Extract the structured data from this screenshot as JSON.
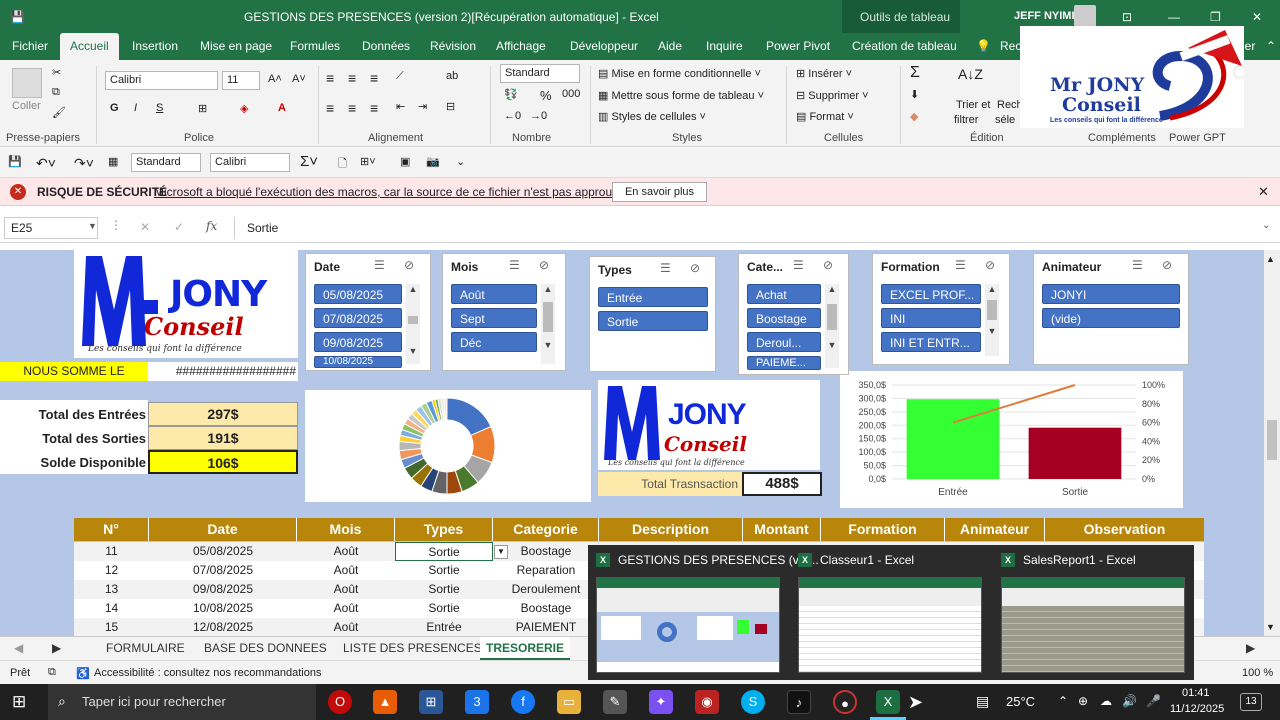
{
  "title": {
    "doc": "GESTIONS DES PRESENCES (version 2)[Récupération automatique]  -  Excel",
    "context_tab": "Outils de tableau",
    "user": "JEFF NYIMI"
  },
  "tabs": [
    "Fichier",
    "Accueil",
    "Insertion",
    "Mise en page",
    "Formules",
    "Données",
    "Révision",
    "Affichage",
    "Développeur",
    "Aide",
    "Inquire",
    "Power Pivot",
    "Création de tableau",
    "Rech",
    "ger"
  ],
  "ribbon": {
    "font_name": "Calibri",
    "font_size": "11",
    "number_format": "Standard",
    "paste": "Coller",
    "groups": [
      "Presse-papiers",
      "Police",
      "Alignement",
      "Nombre",
      "Styles",
      "Cellules",
      "Édition",
      "Compléments",
      "Power GPT"
    ],
    "styles": [
      "Mise en forme conditionnelle",
      "Mettre sous forme de tableau",
      "Styles de cellules"
    ],
    "cells": [
      "Insérer",
      "Supprimer",
      "Format"
    ],
    "edit": [
      "Trier et",
      "filtrer",
      "Rech",
      "séle"
    ],
    "font_btns": [
      "G",
      "I",
      "S"
    ]
  },
  "qat": {
    "format": "Standard",
    "font": "Calibri"
  },
  "security": {
    "label": "RISQUE DE SÉCURITÉ",
    "message": "Microsoft a bloqué l'exécution des macros, car la source de ce fichier n'est pas approuvée.",
    "button": "En savoir plus"
  },
  "formula_bar": {
    "name_box": "E25",
    "fx": "fx",
    "content": "Sortie"
  },
  "logo": {
    "line1": "Mr JONY",
    "line2": "Conseil",
    "tagline": "Les conseils qui font la différence"
  },
  "nous_somme": {
    "label": "NOUS SOMME LE",
    "value": "##################"
  },
  "totals": [
    {
      "label": "Total des Entrées",
      "value": "297$"
    },
    {
      "label": "Total des Sorties",
      "value": "191$"
    },
    {
      "label": "Solde Disponible",
      "value": "106$"
    }
  ],
  "total_trans": {
    "label": "Total Trasnsaction",
    "value": "488$"
  },
  "slicers": {
    "date": {
      "title": "Date",
      "items": [
        "05/08/2025",
        "07/08/2025",
        "09/08/2025",
        "10/08/2025"
      ]
    },
    "mois": {
      "title": "Mois",
      "items": [
        "Août",
        "Sept",
        "Déc"
      ]
    },
    "types": {
      "title": "Types",
      "items": [
        "Entrée",
        "Sortie"
      ]
    },
    "cate": {
      "title": "Cate...",
      "items": [
        "Achat",
        "Boostage",
        "Deroul...",
        "PAIEME..."
      ]
    },
    "formation": {
      "title": "Formation",
      "items": [
        "EXCEL PROF...",
        "INI",
        "INI ET ENTR..."
      ]
    },
    "animateur": {
      "title": "Animateur",
      "items": [
        "JONYI",
        "(vide)"
      ]
    }
  },
  "chart_data": [
    {
      "type": "pie",
      "title": "",
      "slices": [
        18,
        12,
        8,
        6,
        5,
        5,
        4,
        4,
        4,
        3,
        3,
        3,
        2,
        2,
        2,
        2,
        2,
        2,
        2,
        2,
        2,
        1,
        1,
        1,
        1,
        1
      ],
      "colors": [
        "#4472c4",
        "#ed7d31",
        "#a5a5a5",
        "#4c7a2c",
        "#9e480e",
        "#636363",
        "#264478",
        "#997300",
        "#43682b",
        "#698ed0",
        "#f1975a",
        "#b7b7b7",
        "#ffcd33",
        "#7cafdd",
        "#8cc168",
        "#f4b183",
        "#c9c9c9",
        "#ffd966",
        "#9dc3e6",
        "#a9d18e",
        "#5b9bd5",
        "#ffc000",
        "#70ad47",
        "#d9d9d9",
        "#e2efd9",
        "#fbe5d6"
      ]
    },
    {
      "type": "bar",
      "categories": [
        "Entrée",
        "Sortie"
      ],
      "values": [
        297,
        191
      ],
      "colors": [
        "#33ff33",
        "#a50021"
      ],
      "y_ticks": [
        "350,0$",
        "300,0$",
        "250,0$",
        "200,0$",
        "150,0$",
        "100,0$",
        "50,0$",
        "0,0$"
      ],
      "ylim": [
        0,
        350
      ],
      "y2_ticks": [
        "100%",
        "80%",
        "60%",
        "40%",
        "20%",
        "0%"
      ],
      "line_pct": [
        60,
        100
      ],
      "line_color": "#e07b39"
    }
  ],
  "table": {
    "headers": [
      "N°",
      "Date",
      "Mois",
      "Types",
      "Categorie",
      "Description",
      "Montant",
      "Formation",
      "Animateur",
      "Observation"
    ],
    "rows": [
      [
        "11",
        "05/08/2025",
        "Août",
        "Sortie",
        "Boostage"
      ],
      [
        "12",
        "07/08/2025",
        "Août",
        "Sortie",
        "Reparation"
      ],
      [
        "13",
        "09/08/2025",
        "Août",
        "Sortie",
        "Deroulement"
      ],
      [
        "14",
        "10/08/2025",
        "Août",
        "Sortie",
        "Boostage"
      ],
      [
        "15",
        "12/08/2025",
        "Août",
        "Entrée",
        "PAIEMENT"
      ]
    ]
  },
  "sheet_tabs": [
    "FORMULAIRE",
    "BASE DES DONNEES",
    "LISTE DES PRESENCES",
    "TRESORERIE"
  ],
  "status": {
    "ready": "Prêt",
    "access": "Accessibilité : consultez nos recommandations",
    "zoom": "100 %"
  },
  "previews": [
    {
      "label": "GESTIONS DES PRESENCES (ver..."
    },
    {
      "label": "Classeur1 - Excel"
    },
    {
      "label": "SalesReport1 - Excel"
    }
  ],
  "taskbar": {
    "search": "Taper ici pour rechercher",
    "temp": "25°C",
    "time": "01:41",
    "date": "11/12/2025",
    "notif": "13"
  }
}
